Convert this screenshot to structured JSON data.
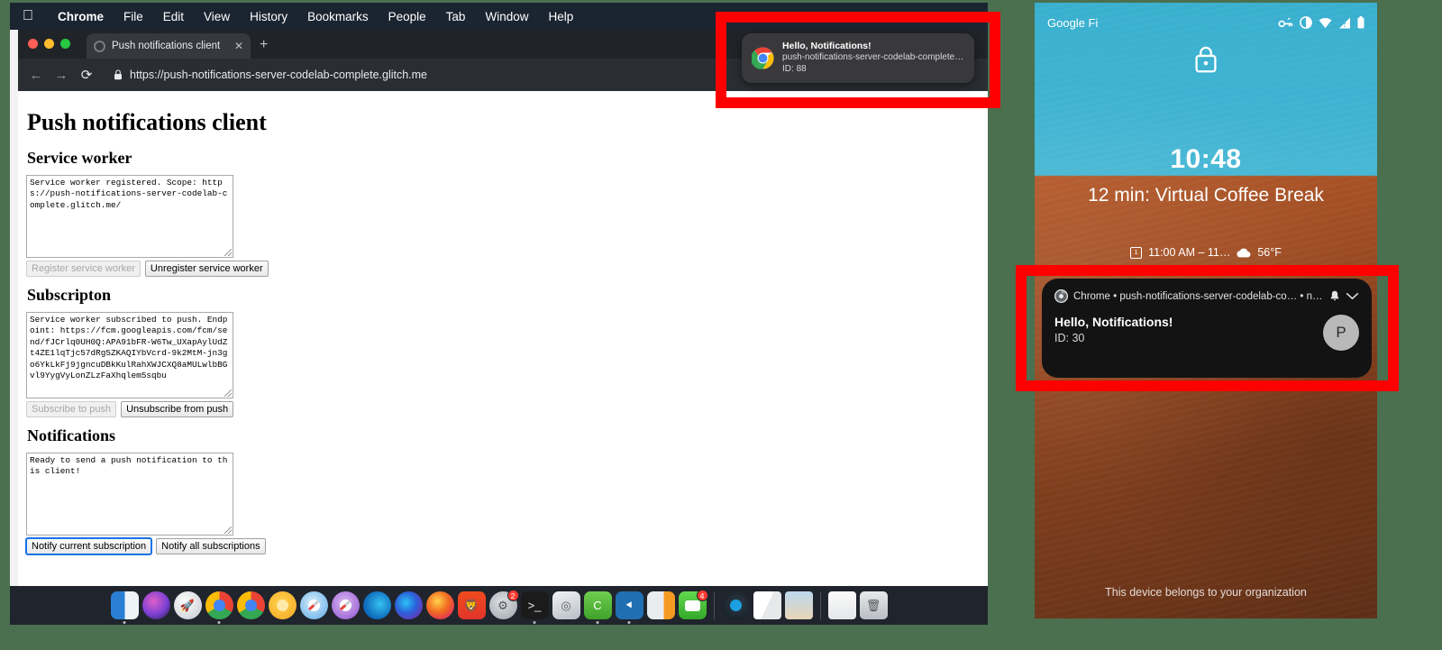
{
  "macos": {
    "menubar": {
      "apple_logo": "apple-logo",
      "items": [
        {
          "label": "Chrome",
          "bold": true
        },
        {
          "label": "File",
          "bold": false
        },
        {
          "label": "Edit",
          "bold": false
        },
        {
          "label": "View",
          "bold": false
        },
        {
          "label": "History",
          "bold": false
        },
        {
          "label": "Bookmarks",
          "bold": false
        },
        {
          "label": "People",
          "bold": false
        },
        {
          "label": "Tab",
          "bold": false
        },
        {
          "label": "Window",
          "bold": false
        },
        {
          "label": "Help",
          "bold": false
        }
      ]
    },
    "notification_toast": {
      "app_icon": "chrome-icon",
      "title": "Hello, Notifications!",
      "source": "push-notifications-server-codelab-complete.glitch…",
      "id_line": "ID: 88"
    },
    "dock": {
      "items": [
        {
          "name": "finder",
          "badge": ""
        },
        {
          "name": "siri",
          "badge": ""
        },
        {
          "name": "launchpad",
          "badge": ""
        },
        {
          "name": "chrome",
          "badge": ""
        },
        {
          "name": "chrome-beta",
          "badge": ""
        },
        {
          "name": "chrome-canary",
          "badge": ""
        },
        {
          "name": "safari",
          "badge": ""
        },
        {
          "name": "safari-technology-preview",
          "badge": ""
        },
        {
          "name": "microsoft-edge",
          "badge": ""
        },
        {
          "name": "firefox-developer-edition",
          "badge": ""
        },
        {
          "name": "firefox",
          "badge": ""
        },
        {
          "name": "brave",
          "badge": ""
        },
        {
          "name": "system-preferences",
          "badge": "2"
        },
        {
          "name": "terminal",
          "badge": ""
        },
        {
          "name": "disk-utility",
          "badge": ""
        },
        {
          "name": "coteditor",
          "badge": ""
        },
        {
          "name": "visual-studio-code",
          "badge": ""
        },
        {
          "name": "numbers",
          "badge": ""
        },
        {
          "name": "messages",
          "badge": "4"
        },
        {
          "name": "separator",
          "badge": ""
        },
        {
          "name": "vivaldi",
          "badge": ""
        },
        {
          "name": "pages-document",
          "badge": ""
        },
        {
          "name": "preview-image",
          "badge": ""
        },
        {
          "name": "separator",
          "badge": ""
        },
        {
          "name": "downloads-stack",
          "badge": ""
        },
        {
          "name": "trash",
          "badge": ""
        }
      ]
    }
  },
  "chrome": {
    "tab": {
      "title": "Push notifications client",
      "close_label": "✕",
      "new_tab_label": "+"
    },
    "toolbar": {
      "back_icon": "←",
      "forward_icon": "→",
      "reload_icon": "⟳",
      "lock_icon": "🔒",
      "url": "https://push-notifications-server-codelab-complete.glitch.me"
    }
  },
  "webpage": {
    "title": "Push notifications client",
    "sections": [
      {
        "heading": "Service worker",
        "log": "Service worker registered. Scope: https://push-notifications-server-codelab-complete.glitch.me/",
        "buttons": [
          {
            "label": "Register service worker",
            "state": "disabled"
          },
          {
            "label": "Unregister service worker",
            "state": "enabled"
          }
        ]
      },
      {
        "heading": "Subscripton",
        "log": "Service worker subscribed to push. Endpoint: https://fcm.googleapis.com/fcm/send/fJCrlq0UH0Q:APA91bFR-W6Tw_UXapAylUdZt4ZE1lqTjc57dRg5ZKAQIYbVcrd-9k2MtM-jn3go6YkLkFj9jgncuDBkKulRahXWJCXQ8aMULwlbBGvl9YygVyLonZLzFaXhqlem5sqbu",
        "buttons": [
          {
            "label": "Subscribe to push",
            "state": "disabled"
          },
          {
            "label": "Unsubscribe from push",
            "state": "enabled"
          }
        ]
      },
      {
        "heading": "Notifications",
        "log": "Ready to send a push notification to this client!",
        "buttons": [
          {
            "label": "Notify current subscription",
            "state": "focused"
          },
          {
            "label": "Notify all subscriptions",
            "state": "enabled"
          }
        ]
      }
    ]
  },
  "android": {
    "status_bar": {
      "carrier": "Google Fi",
      "icons": [
        "vpn-key-icon",
        "do-not-disturb-icon",
        "wifi-icon",
        "cell-signal-icon",
        "battery-icon"
      ]
    },
    "lock_icon": "lock-icon",
    "clock": "10:48",
    "event": "12 min:  Virtual Coffee Break",
    "event_time": "11:00 AM – 11…",
    "weather_icon": "cloud-icon",
    "temperature": "56°F",
    "notification": {
      "app_icon": "chrome-icon",
      "app_name": "Chrome",
      "source": "push-notifications-server-codelab-co…",
      "time": "now",
      "alert_icon": "bell-icon",
      "expand_icon": "chevron-down-icon",
      "title": "Hello, Notifications!",
      "body": "ID: 30",
      "avatar_initial": "P"
    },
    "footer": "This device belongs to your organization"
  },
  "annotations": {
    "highlight_color": "#fe0000",
    "boxes": [
      {
        "name": "macos-notification-highlight"
      },
      {
        "name": "android-notification-highlight"
      }
    ]
  }
}
